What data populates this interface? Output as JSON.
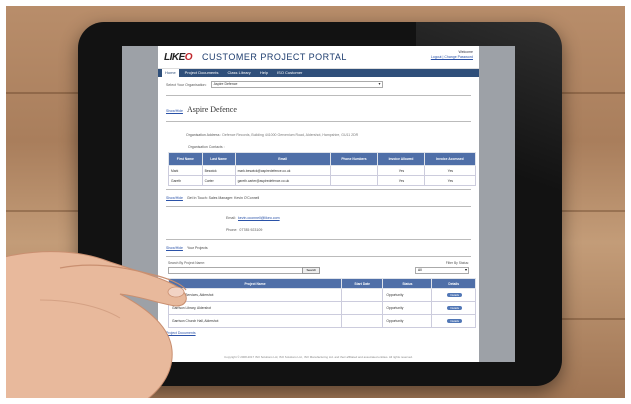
{
  "header": {
    "logo_a": "LIKE",
    "logo_b": "O",
    "title": "CUSTOMER PROJECT PORTAL",
    "welcome": "Welcome",
    "links": "Logout | Change Password"
  },
  "nav": [
    "Home",
    "Project Documents",
    "Class Library",
    "Help",
    "ISO Customer"
  ],
  "org_select": {
    "label": "Select Your Organisation:",
    "value": "Aspire Defence"
  },
  "organisation": {
    "show_label": "Show/Hide",
    "name": "Aspire Defence",
    "address_label": "Organisation Address :",
    "address": "Defence Records, Building 441000 Gervenium Road, Aldershot, Hampshire, GU11 2DR",
    "contacts_label": "Organisation Contacts :"
  },
  "contacts": {
    "columns": [
      "First Name",
      "Last Name",
      "Email",
      "Phone Numbers",
      "Invoice Allowed",
      "Invoice Accessed"
    ],
    "rows": [
      [
        "Mark",
        "Beswick",
        "mark.beswick@aspiredefence.co.uk",
        "",
        "Yes",
        "Yes"
      ],
      [
        "Gareth",
        "Carter",
        "gareth.carter@aspiredefence.co.uk",
        "",
        "Yes",
        "Yes"
      ]
    ]
  },
  "manager": {
    "show_label": "Show/Hide",
    "title": "Get In Touch: Sales Manager: Kevin O'Connell",
    "email_label": "Email:",
    "email": "kevin.oconnell@likeo.com",
    "phone_label": "Phone:",
    "phone": "07785 923109"
  },
  "projects": {
    "show_label": "Show/Hide",
    "title": "Your Projects",
    "search_label": "Search By Project Name:",
    "search_button": "Search",
    "filter_label": "Filter By Status:",
    "filter_value": "All",
    "columns": [
      "Project Name",
      "Start Date",
      "Status",
      "Details"
    ],
    "rows": [
      [
        "Defence Services, Aldershot",
        "",
        "Opportunity",
        "Details"
      ],
      [
        "Garrison Library, Aldershot",
        "",
        "Opportunity",
        "Details"
      ],
      [
        "Garrison Church Hall, Aldershot",
        "",
        "Opportunity",
        "Details"
      ]
    ],
    "documents_link": "Project Documents"
  },
  "footer": "Copyright © 2008-2017 ISO Solutions Ltd, ISO Solutions Ltd., ISO Manufacturing Ltd. and their affiliated and associated entities. All rights reserved.",
  "colors": {
    "nav": "#2f4f7a",
    "table_header": "#4f6fa8",
    "tablet": "#121212"
  }
}
